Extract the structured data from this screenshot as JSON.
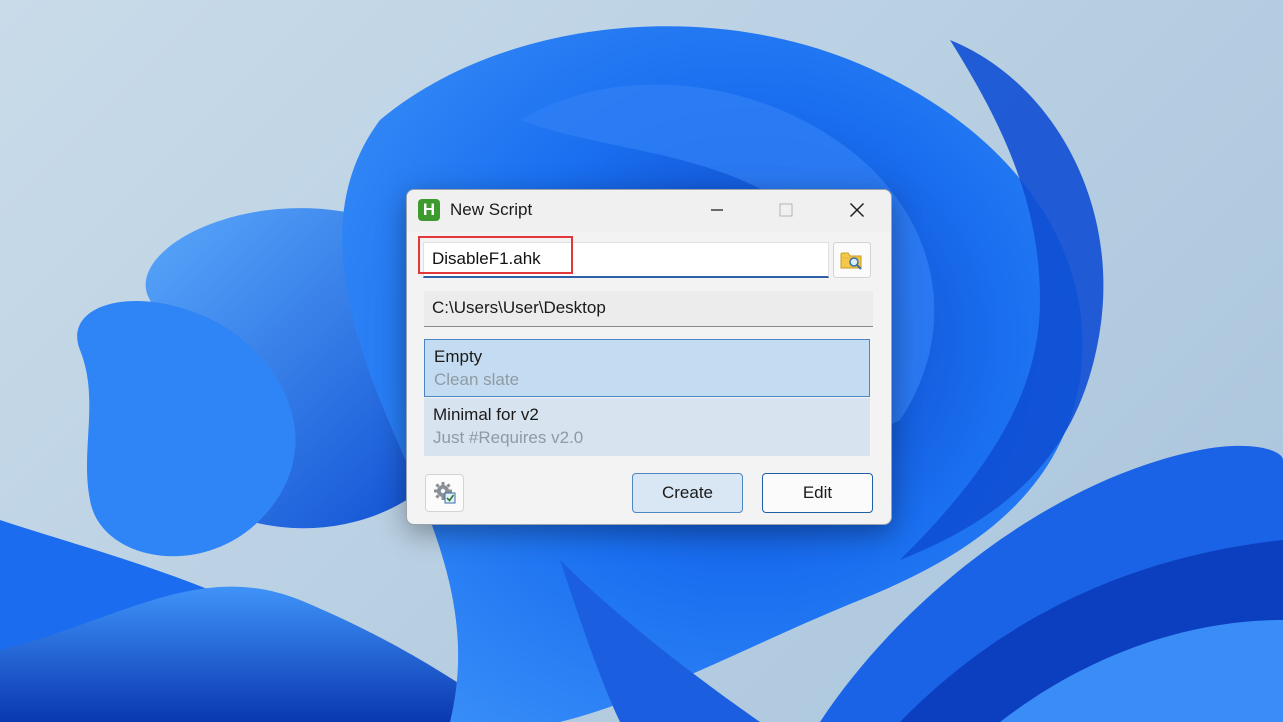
{
  "window": {
    "title": "New Script",
    "app_icon_letter": "H",
    "app_icon_color": "#3d9a2e"
  },
  "form": {
    "filename_value": "DisableF1.ahk",
    "path_value": "C:\\Users\\User\\Desktop"
  },
  "templates": [
    {
      "name": "Empty",
      "description": "Clean slate",
      "selected": true
    },
    {
      "name": "Minimal for v2",
      "description": "Just #Requires v2.0",
      "selected": false
    }
  ],
  "buttons": {
    "create_label": "Create",
    "edit_label": "Edit"
  },
  "icons": {
    "minimize": "minimize-icon",
    "maximize": "maximize-icon",
    "close": "close-icon",
    "browse": "folder-search-icon",
    "settings": "gear-checkbox-icon"
  },
  "colors": {
    "highlight": "#e2383a",
    "selection": "#c4dcf1",
    "accent": "#2f5fa8",
    "wallpaper_blue": "#1664e8"
  }
}
